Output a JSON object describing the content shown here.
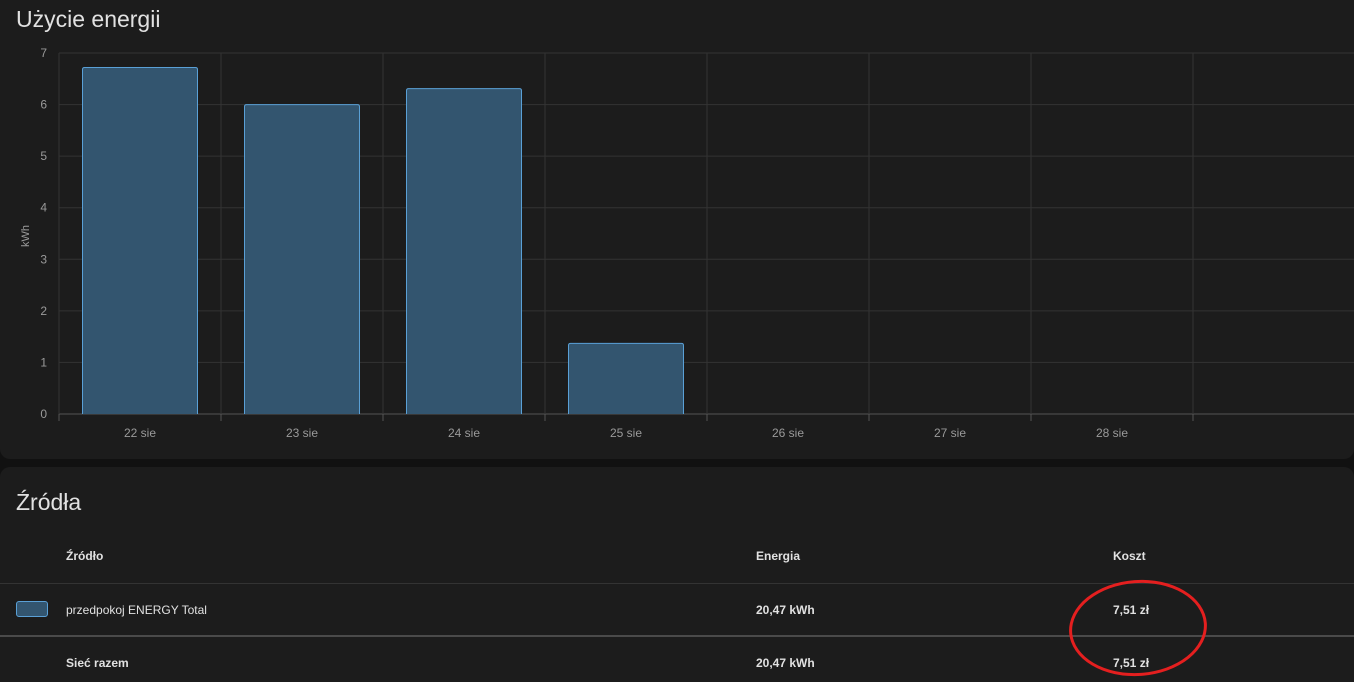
{
  "usage_card": {
    "title": "Użycie energii"
  },
  "sources_card": {
    "title": "Źródła",
    "columns": {
      "source": "Źródło",
      "energy": "Energia",
      "cost": "Koszt"
    },
    "rows": [
      {
        "name": "przedpokoj ENERGY Total",
        "energy": "20,47 kWh",
        "cost": "7,51 zł",
        "swatch_color": "#33556f"
      }
    ],
    "total": {
      "name": "Sieć razem",
      "energy": "20,47 kWh",
      "cost": "7,51 zł"
    }
  },
  "annotation": {
    "color": "#e41f1f"
  },
  "chart_data": {
    "type": "bar",
    "categories": [
      "22 sie",
      "23 sie",
      "24 sie",
      "25 sie",
      "26 sie",
      "27 sie",
      "28 sie"
    ],
    "series": [
      {
        "values": [
          6.72,
          6.0,
          6.31,
          1.37,
          0,
          0,
          0
        ],
        "color": "#33556f",
        "border_color": "#5aa0d6"
      }
    ],
    "ylabel": "kWh",
    "ylim": [
      0,
      7
    ],
    "yticks": [
      0,
      1,
      2,
      3,
      4,
      5,
      6,
      7
    ],
    "grid": true
  }
}
